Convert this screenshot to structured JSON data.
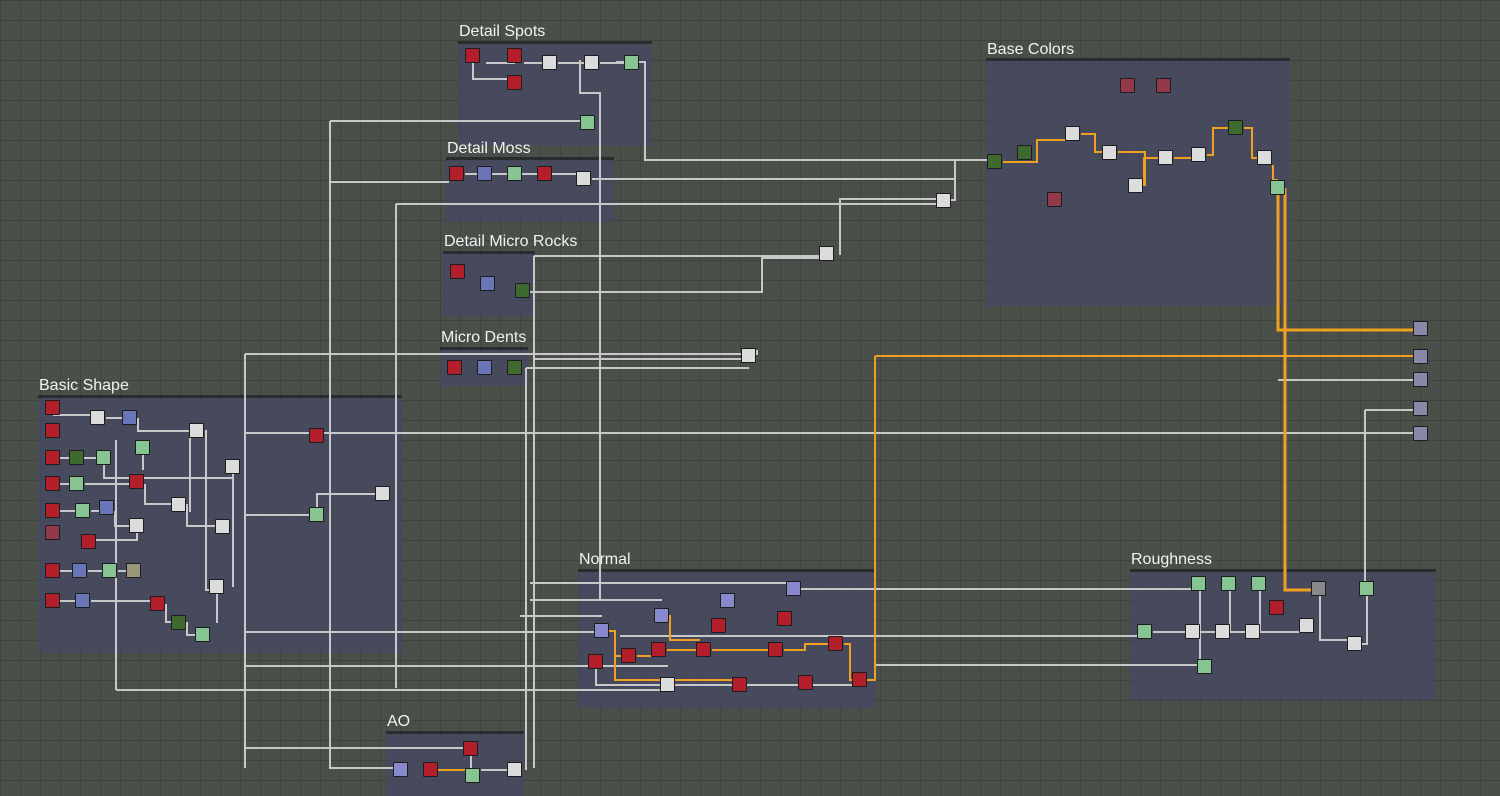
{
  "frames": [
    {
      "id": "detail-spots",
      "title": "Detail Spots"
    },
    {
      "id": "base-colors",
      "title": "Base Colors"
    },
    {
      "id": "detail-moss",
      "title": "Detail Moss"
    },
    {
      "id": "detail-micro-rocks",
      "title": "Detail Micro Rocks"
    },
    {
      "id": "micro-dents",
      "title": "Micro Dents"
    },
    {
      "id": "basic-shape",
      "title": "Basic Shape"
    },
    {
      "id": "normal",
      "title": "Normal"
    },
    {
      "id": "roughness",
      "title": "Roughness"
    },
    {
      "id": "ao",
      "title": "AO"
    }
  ],
  "colors": {
    "background": "#4a4f4a",
    "frame_fill": "#464864",
    "wire": "#c8c8c8",
    "wire_highlight": "#f0a020",
    "node_red": "#b31e2b",
    "node_blue": "#6a75b8",
    "node_light_green": "#86c491",
    "node_dark_green": "#3f6a2f",
    "node_white": "#dcdcdc",
    "node_maroon": "#923848",
    "output_node": "#8a88a8"
  }
}
